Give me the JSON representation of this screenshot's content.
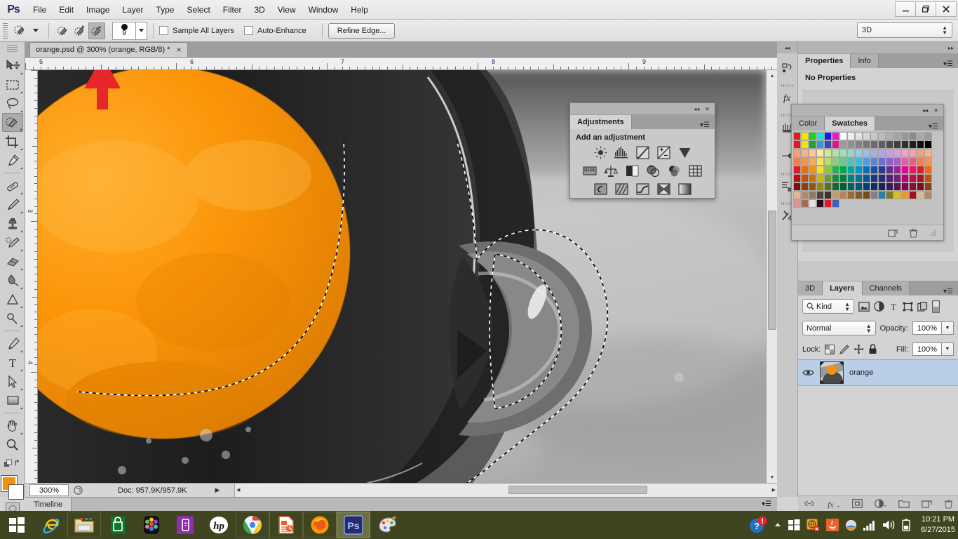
{
  "app": {
    "name": "Adobe Photoshop",
    "logo_text": "Ps"
  },
  "menubar": {
    "items": [
      "File",
      "Edit",
      "Image",
      "Layer",
      "Type",
      "Select",
      "Filter",
      "3D",
      "View",
      "Window",
      "Help"
    ]
  },
  "window_controls": {
    "minimize": "minimize-icon",
    "restore": "restore-icon",
    "close": "close-icon"
  },
  "options_bar": {
    "tool_preset_icon": "quick-selection-preset-icon",
    "modes": [
      {
        "name": "new-selection",
        "active": false
      },
      {
        "name": "add-to-selection",
        "active": false
      },
      {
        "name": "subtract-from-selection",
        "active": true
      }
    ],
    "brush_size": "9",
    "sample_all_layers": {
      "label": "Sample All Layers",
      "checked": false
    },
    "auto_enhance": {
      "label": "Auto-Enhance",
      "checked": false
    },
    "refine_edge_label": "Refine Edge...",
    "workspace": "3D"
  },
  "toolbox": {
    "tools": [
      {
        "name": "move-tool",
        "selected": false
      },
      {
        "name": "rectangular-marquee-tool",
        "selected": false
      },
      {
        "name": "lasso-tool",
        "selected": false
      },
      {
        "name": "quick-selection-tool",
        "selected": true
      },
      {
        "name": "crop-tool",
        "selected": false
      },
      {
        "name": "eyedropper-tool",
        "selected": false
      },
      {
        "name": "spot-healing-brush-tool",
        "selected": false
      },
      {
        "name": "brush-tool",
        "selected": false
      },
      {
        "name": "clone-stamp-tool",
        "selected": false
      },
      {
        "name": "history-brush-tool",
        "selected": false
      },
      {
        "name": "eraser-tool",
        "selected": false
      },
      {
        "name": "gradient-tool",
        "selected": false
      },
      {
        "name": "blur-tool",
        "selected": false
      },
      {
        "name": "dodge-tool",
        "selected": false
      },
      {
        "name": "pen-tool",
        "selected": false
      },
      {
        "name": "horizontal-type-tool",
        "selected": false
      },
      {
        "name": "path-selection-tool",
        "selected": false
      },
      {
        "name": "rectangle-tool",
        "selected": false
      },
      {
        "name": "hand-tool",
        "selected": false
      },
      {
        "name": "zoom-tool",
        "selected": false
      }
    ],
    "foreground_color": "#f79009",
    "background_color": "#ffffff",
    "quick_mask_label": "quick-mask-icon"
  },
  "document": {
    "tab_title": "orange.psd @ 300% (orange, RGB/8) *",
    "close_glyph": "×",
    "ruler_h_labels": [
      "5",
      "6",
      "7",
      "8",
      "9"
    ],
    "ruler_v_labels": [
      "3",
      "4"
    ],
    "annotation": "red-arrow-overlay"
  },
  "status_bar": {
    "zoom": "300%",
    "doc_info": "Doc: 957.9K/957.9K",
    "timeline_tab": "Timeline"
  },
  "adjustments_panel": {
    "tab_label": "Adjustments",
    "heading": "Add an adjustment",
    "collapse_glyph": "◂◂",
    "close_glyph": "✕",
    "row1": [
      "brightness-contrast-icon",
      "levels-icon",
      "curves-icon",
      "exposure-icon",
      "vibrance-icon"
    ],
    "row2": [
      "hue-saturation-icon",
      "color-balance-icon",
      "black-white-icon",
      "photo-filter-icon",
      "channel-mixer-icon",
      "color-lookup-icon"
    ],
    "row3": [
      "invert-icon",
      "posterize-icon",
      "threshold-icon",
      "gradient-map-icon",
      "selective-color-icon"
    ]
  },
  "icon_dock": {
    "items": [
      "history-icon",
      "styles-icon",
      "brush-presets-icon",
      "clone-source-icon",
      "actions-icon",
      "tool-presets-icon"
    ]
  },
  "properties_dock": {
    "tabs": [
      {
        "label": "Properties",
        "active": true
      },
      {
        "label": "Info",
        "active": false
      }
    ],
    "empty_message": "No Properties"
  },
  "swatches_panel": {
    "tabs": [
      {
        "label": "Color",
        "active": false
      },
      {
        "label": "Swatches",
        "active": true
      }
    ],
    "collapse_glyph": "◂◂",
    "close_glyph": "✕",
    "footer_icons": [
      "new-swatch-icon",
      "delete-swatch-icon"
    ],
    "colors": [
      "#e01b24",
      "#f5e400",
      "#1fd014",
      "#19e0e0",
      "#1a1ae0",
      "#f015c9",
      "#ffffff",
      "#efefef",
      "#e2e2e2",
      "#d6d6d6",
      "#c9c9c9",
      "#bdbdbd",
      "#b0b0b0",
      "#a4a4a4",
      "#979797",
      "#8b8b8b",
      "#a8a8a8",
      "#9b9b9b",
      "#e01b24",
      "#f5e400",
      "#1ba33b",
      "#2e9de0",
      "#3b4aa8",
      "#e0148c",
      "#9b9b9b",
      "#8f8f8f",
      "#838383",
      "#777777",
      "#6b6b6b",
      "#5f5f5f",
      "#4f4f4f",
      "#3f3f3f",
      "#2f2f2f",
      "#1f1f1f",
      "#101010",
      "#000000",
      "#f5a07a",
      "#f7b48c",
      "#f9c79c",
      "#fbe9a0",
      "#d2e79e",
      "#b6e0a5",
      "#a3dcbb",
      "#96d6cd",
      "#8fd0e5",
      "#9fbce8",
      "#a6aee0",
      "#b0a6dd",
      "#c1a4db",
      "#d1a3d6",
      "#efa3cb",
      "#f2a0b2",
      "#f5a07a",
      "#f7b48c",
      "#f07f4f",
      "#f4934f",
      "#f7ab58",
      "#f9e45e",
      "#b8dd72",
      "#8ed07a",
      "#6ec894",
      "#52c3b6",
      "#37bde0",
      "#4f9fe0",
      "#5b83d6",
      "#6b6fd0",
      "#8a62c8",
      "#a75fc0",
      "#e05fa8",
      "#ea5f8a",
      "#f07f4f",
      "#f4934f",
      "#e01b24",
      "#ef6a12",
      "#f0930e",
      "#f7e511",
      "#8cc63f",
      "#22b14c",
      "#00a651",
      "#00a69c",
      "#0095c8",
      "#0071bc",
      "#1b4fa0",
      "#2b3990",
      "#662d91",
      "#92278f",
      "#ec008c",
      "#ed145b",
      "#e01b24",
      "#ef6a12",
      "#b01217",
      "#c05210",
      "#c4740c",
      "#c7b60e",
      "#6f9c32",
      "#1a8c3c",
      "#007f3e",
      "#00837a",
      "#00759c",
      "#005893",
      "#153c80",
      "#222d72",
      "#4f2273",
      "#721e71",
      "#b80070",
      "#b90f49",
      "#b01217",
      "#c05210",
      "#7d0d11",
      "#8f3d0c",
      "#915609",
      "#95880a",
      "#537426",
      "#12682d",
      "#005f2e",
      "#00625b",
      "#005675",
      "#00426e",
      "#0f2d60",
      "#192256",
      "#3b1957",
      "#551655",
      "#8a0054",
      "#8a0b36",
      "#7d0d11",
      "#8f3d0c",
      "#dbb79a",
      "#b08b6a",
      "#8f7a63",
      "#4d433c",
      "#3a332c",
      "#c39a6b",
      "#b4845a",
      "#9c6b3a",
      "#8a5a25",
      "#7a4a17",
      "#8a7a8f",
      "#2e7fa8",
      "#80772a",
      "#d4bf2a",
      "#e89c22",
      "#a81010",
      "#dbb79a",
      "#b08b6a",
      "#e09090",
      "#a86a4a",
      "#e4e4dc",
      "#2a0a14",
      "#e01b24",
      "#3a5fc0"
    ]
  },
  "layers_panel": {
    "tabs": [
      {
        "label": "3D",
        "active": false
      },
      {
        "label": "Layers",
        "active": true
      },
      {
        "label": "Channels",
        "active": false
      }
    ],
    "filter_label": "Kind",
    "filter_icons": [
      "pixel-layers-icon",
      "adjustment-layers-icon",
      "type-layers-icon",
      "shape-layers-icon",
      "smart-object-icon"
    ],
    "blend_mode": "Normal",
    "opacity_label": "Opacity:",
    "opacity_value": "100%",
    "lock_label": "Lock:",
    "lock_icons": [
      "lock-transparency-icon",
      "lock-image-icon",
      "lock-position-icon",
      "lock-all-icon"
    ],
    "fill_label": "Fill:",
    "fill_value": "100%",
    "layers": [
      {
        "name": "orange",
        "visible": true,
        "selected": true
      }
    ],
    "footer_icons": [
      "link-layers-icon",
      "layer-style-fx-icon",
      "add-mask-icon",
      "new-adjustment-layer-icon",
      "new-group-icon",
      "new-layer-icon",
      "delete-layer-icon"
    ]
  },
  "taskbar": {
    "items": [
      {
        "name": "start-button",
        "label": "Start"
      },
      {
        "name": "internet-explorer-button",
        "label": "Internet Explorer"
      },
      {
        "name": "file-explorer-button",
        "label": "File Explorer"
      },
      {
        "name": "store-button",
        "label": "Store"
      },
      {
        "name": "apps-button",
        "label": "Apps"
      },
      {
        "name": "screen-cast-button",
        "label": "Screen Cast"
      },
      {
        "name": "hp-button",
        "label": "HP"
      },
      {
        "name": "chrome-button",
        "label": "Google Chrome"
      },
      {
        "name": "publisher-button",
        "label": "Publisher"
      },
      {
        "name": "firefox-button",
        "label": "Firefox"
      },
      {
        "name": "photoshop-button",
        "label": "Photoshop",
        "active": true
      },
      {
        "name": "paint-button",
        "label": "Paint"
      }
    ],
    "tray": {
      "icons": [
        "action-center-alert-icon",
        "show-hidden-icons-icon",
        "windows-icon",
        "network-error-icon",
        "java-icon",
        "display-icon",
        "signal-icon",
        "volume-icon",
        "battery-icon"
      ],
      "time": "10:21 PM",
      "date": "6/27/2015"
    }
  }
}
